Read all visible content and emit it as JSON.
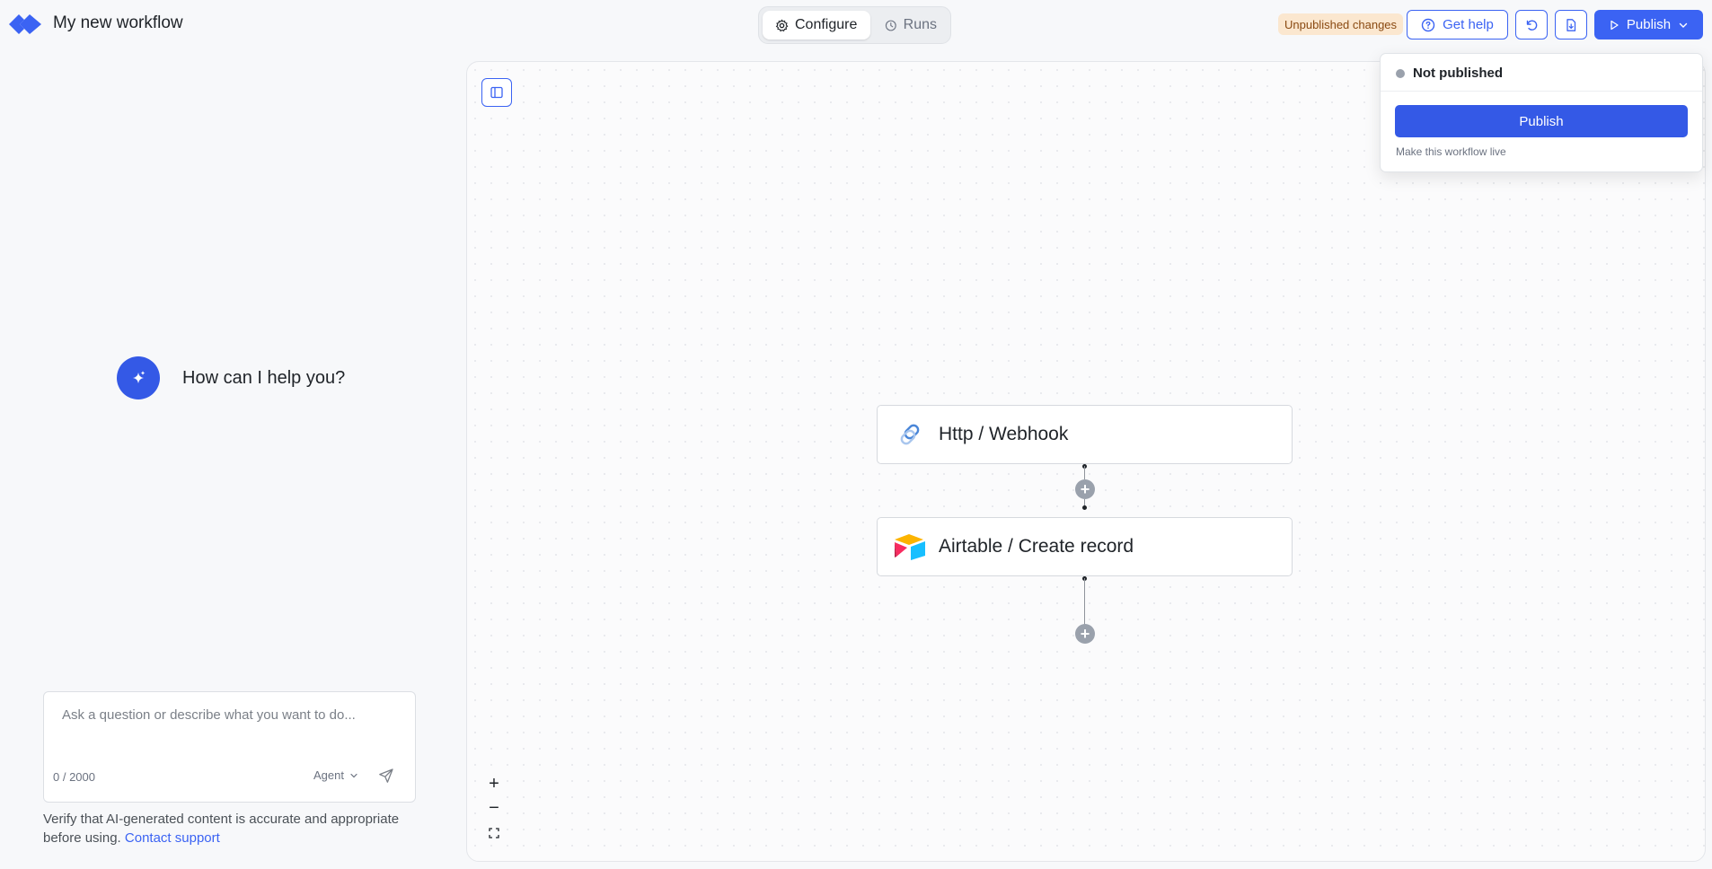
{
  "header": {
    "workflow_title": "My new workflow",
    "tabs": [
      {
        "label": "Configure",
        "icon": "gear-icon",
        "active": true
      },
      {
        "label": "Runs",
        "icon": "clock-icon",
        "active": false
      }
    ],
    "status_badge": "Unpublished changes",
    "help_label": "Get help",
    "publish_label": "Publish"
  },
  "assistant": {
    "greeting": "How can I help you?",
    "input_placeholder": "Ask a question or describe what you want to do...",
    "char_count": "0 / 2000",
    "mode": "Agent",
    "disclaimer": "Verify that AI-generated content is accurate and appropriate before using.",
    "support_link": "Contact support"
  },
  "canvas": {
    "nodes": [
      {
        "label": "Http / Webhook",
        "icon": "link-icon"
      },
      {
        "label": "Airtable / Create record",
        "icon": "airtable-icon"
      }
    ],
    "zoom_controls": [
      "+",
      "−"
    ]
  },
  "publish_popover": {
    "status": "Not published",
    "button_label": "Publish",
    "hint": "Make this workflow live"
  },
  "colors": {
    "accent": "#3b63f3",
    "badge_bg": "#fbe7cf",
    "badge_text": "#8a4a12"
  }
}
